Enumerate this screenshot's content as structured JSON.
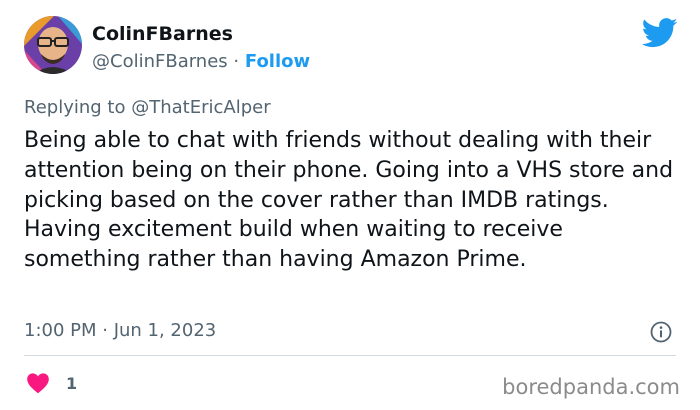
{
  "author": {
    "display_name": "ColinFBarnes",
    "handle": "@ColinFBarnes",
    "separator": "·",
    "follow_label": "Follow"
  },
  "reply": {
    "prefix": "Replying to",
    "mention": "@ThatEricAlper"
  },
  "tweet": {
    "text": "Being able to chat with friends without dealing with their attention being on their phone. Going into a VHS store and picking based on the cover rather than IMDB ratings. Having excitement build when waiting to receive something rather than having Amazon Prime.",
    "timestamp": "1:00 PM · Jun 1, 2023"
  },
  "actions": {
    "like_count": "1"
  },
  "watermark": "boredpanda.com",
  "icons": {
    "brand": "twitter-bird-icon",
    "info": "info-icon",
    "like": "heart-icon"
  },
  "colors": {
    "accent": "#1d9bf0",
    "text": "#0f1419",
    "secondary": "#536471",
    "heart": "#f91880",
    "divider": "#cfd9de"
  }
}
